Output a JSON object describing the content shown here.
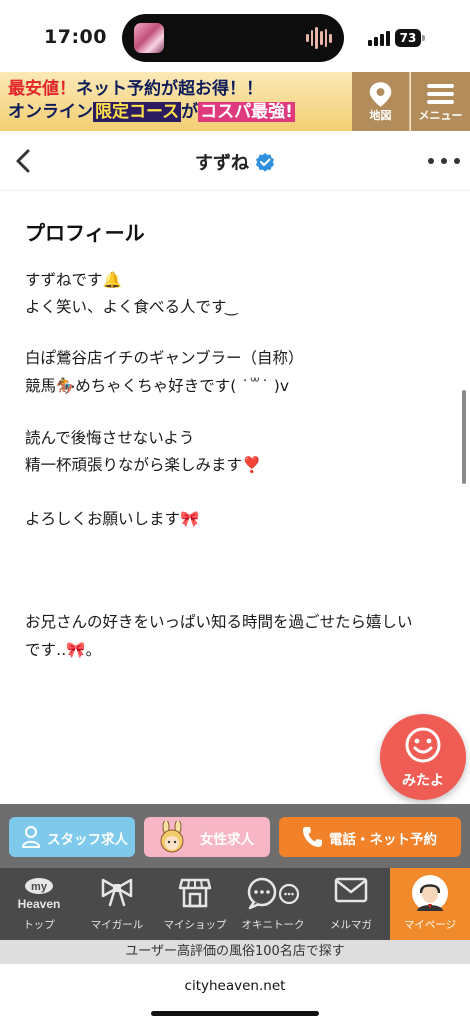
{
  "status_bar": {
    "time": "17:00",
    "battery": "73"
  },
  "banner": {
    "line1_prefix": "最安値！",
    "line1_rest": "ネット予約が超お得！！",
    "line2_prefix": "オンライン",
    "line2_hl": "限定コース",
    "line2_mid": "が",
    "line2_hl2": "コスパ最強!",
    "map_label": "地図",
    "menu_label": "メニュー"
  },
  "header": {
    "title": "すずね"
  },
  "profile": {
    "heading": "プロフィール",
    "lines": [
      "すずねです🔔",
      "よく笑い、よく食べる人です ͜",
      "",
      "白ぽ鶯谷店イチのギャンブラー（自称）",
      "競馬🏇めちゃくちゃ好きです( ˙꒳˙ )v",
      "",
      "読んで後悔させないよう",
      "精一杯頑張りながら楽しみます❣️",
      "",
      "よろしくお願いします🎀",
      "",
      "",
      "",
      "お兄さんの好きをいっぱい知る時間を過ごせたら嬉しい",
      "です‥🎀。"
    ]
  },
  "mitayo": {
    "label": "みたよ"
  },
  "recruit": {
    "staff_label": "スタッフ求人",
    "female_label": "女性求人",
    "call_label": "電話・ネット予約"
  },
  "tabs": [
    {
      "label": "トップ",
      "icon": "my-heaven-logo-icon",
      "logo_top": "my",
      "logo_bottom": "Heaven"
    },
    {
      "label": "マイガール",
      "icon": "ribbon-icon"
    },
    {
      "label": "マイショップ",
      "icon": "shop-icon"
    },
    {
      "label": "オキニトーク",
      "icon": "chat-bubbles-icon"
    },
    {
      "label": "メルマガ",
      "icon": "mail-icon"
    },
    {
      "label": "マイページ",
      "icon": "user-avatar-icon"
    }
  ],
  "promo_strip": "ユーザー高評価の風俗100名店で探す",
  "url": "cityheaven.net",
  "colors": {
    "banner_bg": "#b28c5a",
    "staff": "#7fc9ec",
    "female": "#f7b6c5",
    "call": "#f2822a",
    "tab_bar": "#4a4a4a",
    "tab_active": "#f08a2a",
    "mitayo": "#ee5c54"
  }
}
